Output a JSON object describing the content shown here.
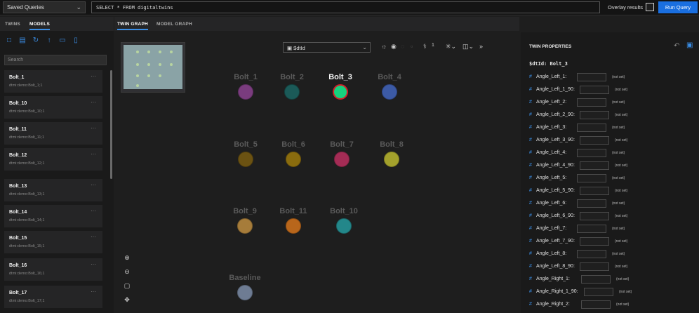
{
  "topbar": {
    "saved_queries": "Saved Queries",
    "query_text": "SELECT * FROM digitaltwins",
    "overlay_label": "Overlay results",
    "run_label": "Run Query"
  },
  "left_panel": {
    "tabs": [
      "TWINS",
      "MODELS"
    ],
    "search_placeholder": "Search",
    "models": [
      {
        "name": "Bolt_1",
        "id": "dtmi:demo:Bolt_1;1"
      },
      {
        "name": "Bolt_10",
        "id": "dtmi:demo:Bolt_10;1"
      },
      {
        "name": "Bolt_11",
        "id": "dtmi:demo:Bolt_11;1"
      },
      {
        "name": "Bolt_12",
        "id": "dtmi:demo:Bolt_12;1"
      },
      {
        "name": "Bolt_13",
        "id": "dtmi:demo:Bolt_13;1"
      },
      {
        "name": "Bolt_14",
        "id": "dtmi:demo:Bolt_14;1"
      },
      {
        "name": "Bolt_15",
        "id": "dtmi:demo:Bolt_15;1"
      },
      {
        "name": "Bolt_16",
        "id": "dtmi:demo:Bolt_16;1"
      },
      {
        "name": "Bolt_17",
        "id": "dtmi:demo:Bolt_17;1"
      }
    ],
    "more_label": "···"
  },
  "graph": {
    "tabs": [
      "TWIN GRAPH",
      "MODEL GRAPH"
    ],
    "layout_value": "$dtId",
    "layout_icon": "label-icon",
    "toolbar_count": "1",
    "nodes": [
      {
        "label": "Bolt_1",
        "color": "#7a3c7e",
        "selected": false
      },
      {
        "label": "Bolt_2",
        "color": "#1b5a58",
        "selected": false
      },
      {
        "label": "Bolt_3",
        "color": "#16d27e",
        "selected": true
      },
      {
        "label": "Bolt_4",
        "color": "#3c5aa5",
        "selected": false
      },
      {
        "label": "Bolt_5",
        "color": "#6b5212",
        "selected": false
      },
      {
        "label": "Bolt_6",
        "color": "#8a6c0e",
        "selected": false
      },
      {
        "label": "Bolt_7",
        "color": "#a42c55",
        "selected": false
      },
      {
        "label": "Bolt_8",
        "color": "#a3a12c",
        "selected": false
      },
      {
        "label": "Bolt_9",
        "color": "#a67c3a",
        "selected": false
      },
      {
        "label": "Bolt_11",
        "color": "#b8661b",
        "selected": false
      },
      {
        "label": "Bolt_10",
        "color": "#23878a",
        "selected": false
      },
      {
        "label": "Baseline",
        "color": "#6e7c93",
        "selected": false
      }
    ]
  },
  "properties": {
    "title": "TWIN PROPERTIES",
    "dtid_label": "$dtId: Bolt_3",
    "not_set": "(not set)",
    "items": [
      "Angle_Left_1:",
      "Angle_Left_1_90:",
      "Angle_Left_2:",
      "Angle_Left_2_90:",
      "Angle_Left_3:",
      "Angle_Left_3_90:",
      "Angle_Left_4:",
      "Angle_Left_4_90:",
      "Angle_Left_5:",
      "Angle_Left_5_90:",
      "Angle_Left_6:",
      "Angle_Left_6_90:",
      "Angle_Left_7:",
      "Angle_Left_7_90:",
      "Angle_Left_8:",
      "Angle_Left_8_90:",
      "Angle_Right_1:",
      "Angle_Right_1_90:",
      "Angle_Right_2:"
    ]
  }
}
